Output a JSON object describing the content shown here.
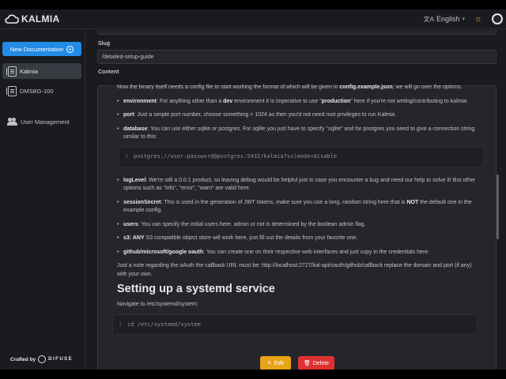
{
  "header": {
    "app_title": "KALMIA",
    "language": "English",
    "language_icon": "translate-icon",
    "theme_icon": "sun-icon",
    "accent": "#228be6"
  },
  "sidebar": {
    "new_button": "New Documentation",
    "items": [
      {
        "label": "Kalmia",
        "active": true
      },
      {
        "label": "DMSBG-100",
        "active": false
      },
      {
        "label": "User Management",
        "active": false
      }
    ],
    "crafted_by": "Crafted by",
    "crafted_brand": "DIFUSE"
  },
  "form": {
    "slug_label": "Slug",
    "slug_value": "/detailed-setup-guide",
    "content_label": "Content"
  },
  "content": {
    "intro_a": "Now the binary itself needs a config file to start working the format of which will be given in ",
    "intro_file": "config.example.json",
    "intro_b": ", we will go over the options.",
    "env_key": "environment",
    "env_a": ": For anything other than a ",
    "env_dev": "dev",
    "env_b": " environment it is imperative to use \"",
    "env_prod": "production",
    "env_c": "\" here if you're not writing/contributing to kalmia.",
    "port_key": "port",
    "port_text": ": Just a simple port number, choose something > 1024 as then you'd not need root privileges to run Kalmia.",
    "db_key": "database",
    "db_text": ": You can use either sqlite or postgres. For sqlite you just have to specify \"sqlite\" and for postgres you need to give a connection string similar to this:",
    "code1_line": "1",
    "code1": "postgres://user:password@postgres:5432/kalmia?sslmode=disable",
    "log_key": "logLevel",
    "log_text": ": We're still a 0.0.1 product, so leaving debug would be helpful just in case you encounter a bug and need our help to solve it! But other options such as \"info\", \"error\", \"warn\" are valid here.",
    "secret_key": "sessionSecret",
    "secret_a": ": This is used in the generation of JWT tokens, make sure you use a long, random string here that is ",
    "secret_not": "NOT",
    "secret_b": " the default one in the example config.",
    "users_key": "users",
    "users_text": ": You can specify the initial users here. admin or not is determined by the boolean admin flag.",
    "s3_key": "s3",
    "s3_any": "ANY",
    "s3_text": " S3 compatible object store will work here, just fill out the details from your favorite one.",
    "oauth_key": "github/microsoft/google oauth",
    "oauth_text": ": You can create one on their respective web interfaces and just copy in the credentials here.",
    "note": "Just a note regarding the oAuth the callback URL must be: http://localhost:2727/kal-api/oauth/github/callback replace the domain and port (if any) with your own.",
    "heading": "Setting up a systemd service",
    "navigate": "Navigate to /etc/systemd/system:",
    "code2_line": "1",
    "code2": "cd /etc/systemd/system"
  },
  "actions": {
    "edit": "Edit",
    "delete": "Delete",
    "edit_color": "#e8a317",
    "delete_color": "#e03131"
  }
}
